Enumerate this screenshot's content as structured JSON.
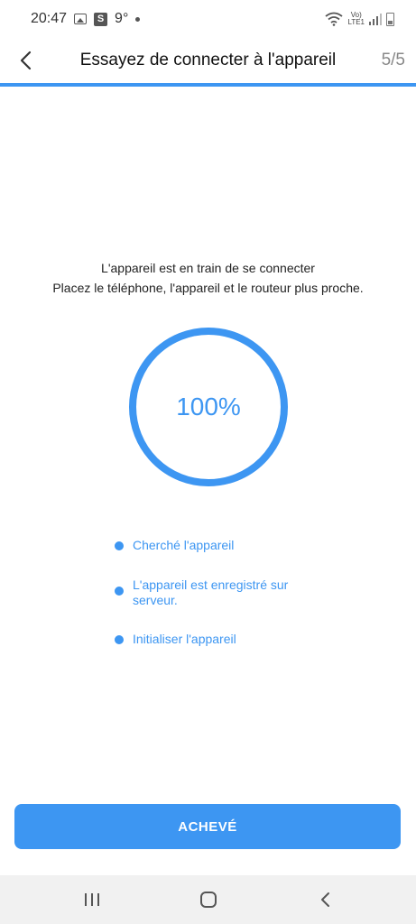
{
  "status_bar": {
    "time": "20:47",
    "temperature": "9°",
    "network_label_top": "Vo)",
    "network_label_bottom": "LTE1",
    "icons": [
      "gallery-icon",
      "s-app-icon",
      "dot-icon",
      "wifi-icon",
      "signal-icon",
      "battery-icon"
    ]
  },
  "header": {
    "title": "Essayez de connecter à l'appareil",
    "step": "5/5",
    "back_icon": "chevron-left-icon"
  },
  "message": {
    "line1": "L'appareil est en train de se connecter",
    "line2": "Placez le téléphone, l'appareil et le routeur plus proche."
  },
  "progress": {
    "value": 100,
    "label": "100%"
  },
  "steps": [
    {
      "label": "Cherché l'appareil"
    },
    {
      "label": "L'appareil est enregistré sur serveur."
    },
    {
      "label": "Initialiser l'appareil"
    }
  ],
  "done_button": {
    "label": "ACHEVÉ"
  },
  "colors": {
    "accent": "#3d96f2",
    "nav_background": "#f1f1f1"
  },
  "nav_bar": {
    "icons": [
      "recent-apps-icon",
      "home-icon",
      "back-icon"
    ]
  }
}
